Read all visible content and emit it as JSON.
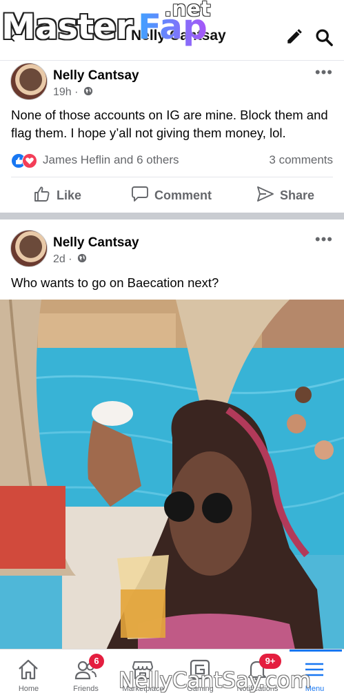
{
  "header": {
    "title": "Nelly Cantsay",
    "watermark": {
      "brand_a": "Master",
      "brand_b": "Fap",
      "brand_c": ".net"
    }
  },
  "posts": [
    {
      "author": "Nelly Cantsay",
      "time": "19h",
      "text": "None of those accounts on IG are mine. Block them and flag them. I hope y’all not giving them money, lol.",
      "reactions": "James Heflin and 6 others",
      "comments": "3 comments"
    },
    {
      "author": "Nelly Cantsay",
      "time": "2d",
      "text": "Who wants to go on Baecation next?"
    }
  ],
  "actions": {
    "like": "Like",
    "comment": "Comment",
    "share": "Share"
  },
  "bottom_nav": {
    "items": [
      {
        "label": "Home",
        "icon": "home-icon"
      },
      {
        "label": "Friends",
        "icon": "friends-icon",
        "badge": "6"
      },
      {
        "label": "Marketplace",
        "icon": "marketplace-icon"
      },
      {
        "label": "Gaming",
        "icon": "gaming-icon"
      },
      {
        "label": "Notifications",
        "icon": "bell-icon",
        "badge": "9+"
      },
      {
        "label": "Menu",
        "icon": "menu-icon"
      }
    ],
    "footer_watermark": "NellyCantSay.com"
  },
  "colors": {
    "accent": "#1877f2",
    "badge": "#e41e3f",
    "muted": "#65676b"
  }
}
